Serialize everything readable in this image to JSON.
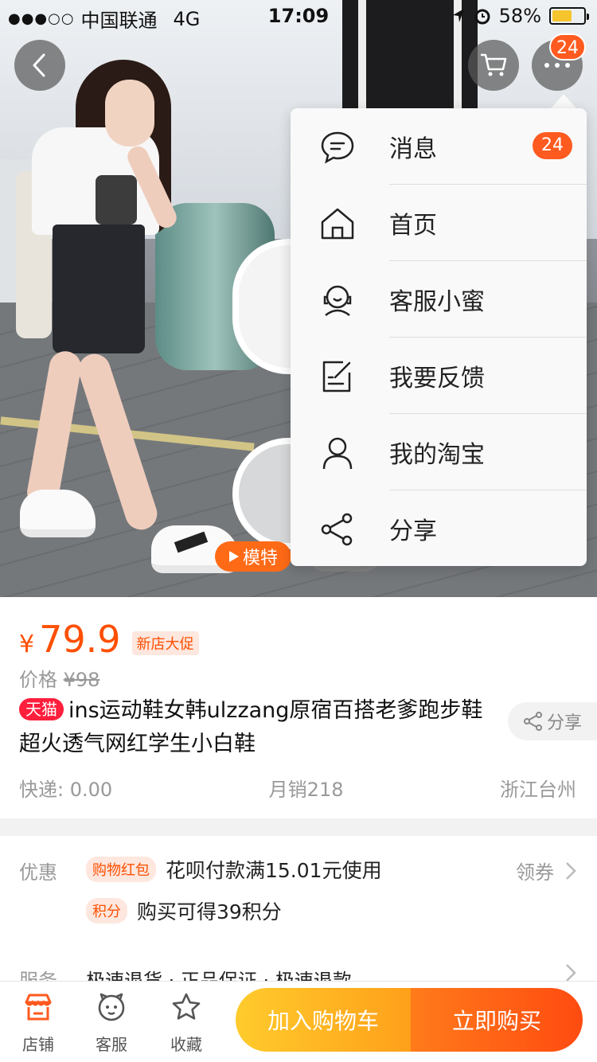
{
  "status_bar": {
    "signal": "●●●○○",
    "carrier": "中国联通",
    "network": "4G",
    "time": "17:09",
    "battery": "58%"
  },
  "header": {
    "back_icon": "chevron-left-icon",
    "cart_icon": "cart-icon",
    "more_icon": "more-dots-icon",
    "more_badge": "24"
  },
  "menu": {
    "items": [
      {
        "icon": "message-icon",
        "label": "消息",
        "badge": "24"
      },
      {
        "icon": "home-icon",
        "label": "首页"
      },
      {
        "icon": "customer-service-icon",
        "label": "客服小蜜"
      },
      {
        "icon": "feedback-icon",
        "label": "我要反馈"
      },
      {
        "icon": "user-icon",
        "label": "我的淘宝"
      },
      {
        "icon": "share-icon",
        "label": "分享"
      }
    ]
  },
  "hero": {
    "model_tag": "模特"
  },
  "product": {
    "currency": "¥",
    "price": "79.9",
    "promo_tag": "新店大促",
    "orig_label": "价格",
    "orig_price": "¥98",
    "store_badge": "天猫",
    "title": "ins运动鞋女韩ulzzang原宿百搭老爹跑步鞋超火透气网红学生小白鞋",
    "share_label": "分享",
    "shipping": "快递: 0.00",
    "monthly_sales": "月销218",
    "location": "浙江台州"
  },
  "promo": {
    "label": "优惠",
    "red_packet_tag": "购物红包",
    "red_packet_text": "花呗付款满15.01元使用",
    "coupon_label": "领券",
    "points_tag": "积分",
    "points_text": "购买可得39积分",
    "service_label": "服务",
    "service_items": "极速退货 · 正品保证 · 极速退款"
  },
  "bottom_bar": {
    "shop": "店铺",
    "service": "客服",
    "favorite": "收藏",
    "add_to_cart": "加入购物车",
    "buy_now": "立即购买"
  },
  "colors": {
    "accent": "#ff4f00",
    "badge": "#ff5a1f",
    "tmall": "#ff1e3c",
    "cart_button": "#ffa01a",
    "buy_button": "#ff4b10"
  }
}
